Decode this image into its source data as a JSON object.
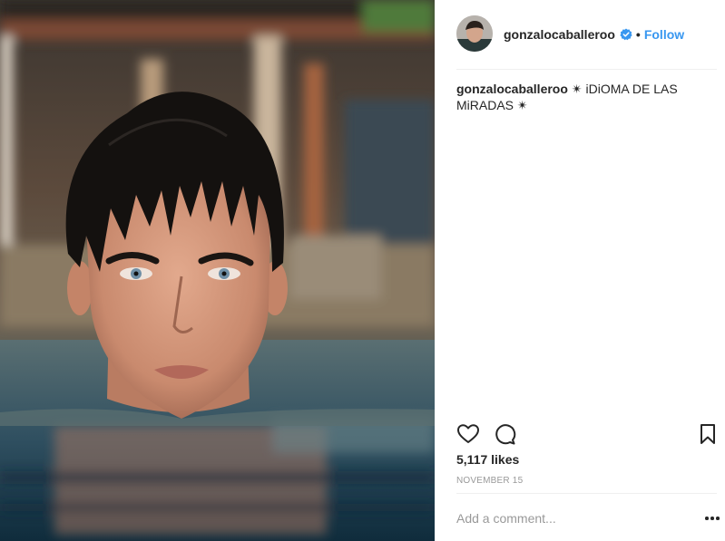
{
  "post": {
    "username": "gonzalocaballeroo",
    "separator": "•",
    "follow_label": "Follow",
    "caption_username": "gonzalocaballeroo",
    "caption_text": "✴ iDiOMA DE LAS MiRADAS ✴",
    "likes": "5,117 likes",
    "date": "NOVEMBER 15",
    "comment_placeholder": "Add a comment..."
  },
  "icons": {
    "verified": "verified-badge-icon",
    "like": "heart-icon",
    "comment": "comment-bubble-icon",
    "save": "bookmark-icon",
    "more": "more-options-icon"
  },
  "colors": {
    "accent": "#3897f0",
    "text": "#262626",
    "muted": "#999999",
    "divider": "#efefef"
  }
}
